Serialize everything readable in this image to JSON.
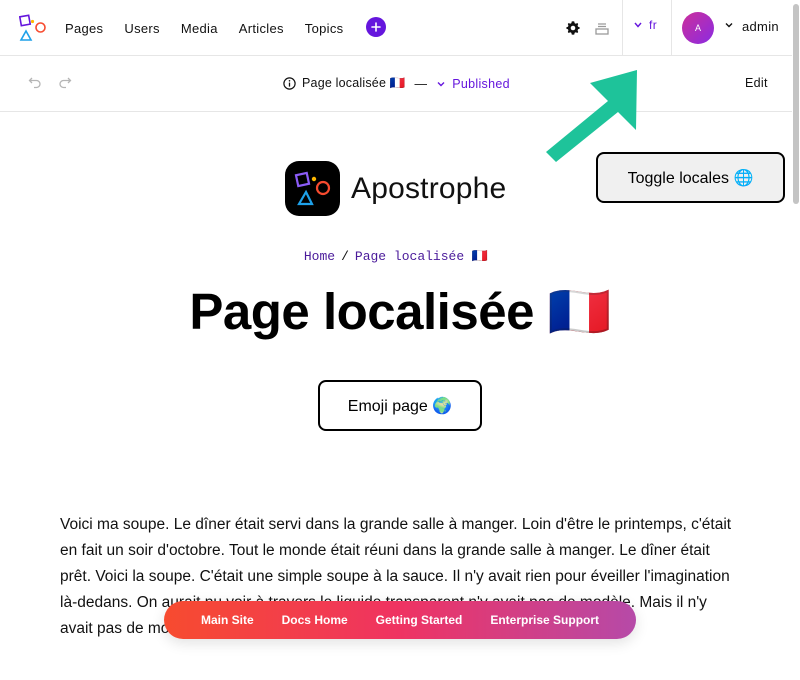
{
  "admin_bar": {
    "logo_icon": "apostrophe-logo-icon",
    "nav": [
      {
        "label": "Pages"
      },
      {
        "label": "Users"
      },
      {
        "label": "Media"
      },
      {
        "label": "Articles"
      },
      {
        "label": "Topics"
      }
    ],
    "add_icon": "plus-icon",
    "settings_icon": "gear-icon",
    "tray_icon": "tray-icon",
    "locale": "fr",
    "avatar_initial": "A",
    "user": "admin"
  },
  "context_bar": {
    "undo_icon": "undo-icon",
    "redo_icon": "redo-icon",
    "doc_title": "Page localisée 🇫🇷",
    "dash": "—",
    "status": "Published",
    "edit_label": "Edit"
  },
  "page": {
    "brand_name": "Apostrophe",
    "breadcrumb": {
      "home": "Home",
      "sep": "/",
      "current": "Page localisée 🇫🇷"
    },
    "title": "Page localisée 🇫🇷",
    "emoji_button": "Emoji page 🌍",
    "toggle_button": "Toggle locales 🌐",
    "body": "Voici ma soupe. Le dîner était servi dans la grande salle à manger. Loin d'être le printemps, c'était en fait un soir d'octobre. Tout le monde était réuni dans la grande salle à manger. Le dîner était prêt. Voici la soupe. C'était une simple soupe à la sauce. Il n'y avait rien pour éveiller l'imagination là-dedans. On aurait pu voir à travers le liquide transparent n'y avait pas de modèle. Mais il n'y avait pas de modèle."
  },
  "footer": {
    "links": [
      {
        "label": "Main Site"
      },
      {
        "label": "Docs Home"
      },
      {
        "label": "Getting Started"
      },
      {
        "label": "Enterprise Support"
      }
    ]
  },
  "colors": {
    "accent": "#6516dd",
    "arrow": "#1ec39a",
    "footer_gradient": [
      "#f74b2f",
      "#ef3362",
      "#b64aa8"
    ]
  }
}
